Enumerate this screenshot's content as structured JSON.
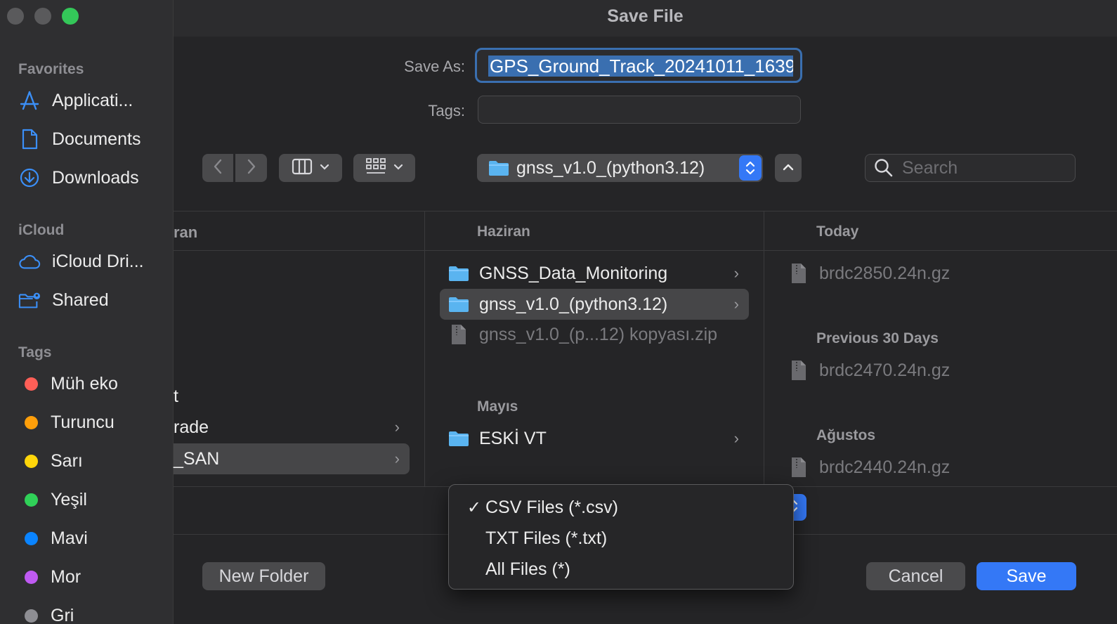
{
  "window": {
    "title": "Save File"
  },
  "save_as": {
    "label": "Save As:",
    "value": "GPS_Ground_Track_20241011_1639"
  },
  "tags_field": {
    "label": "Tags:",
    "value": ""
  },
  "toolbar": {
    "back_icon": "chevron-left-icon",
    "forward_icon": "chevron-right-icon",
    "view_icon": "columns-icon",
    "group_icon": "grid-icon",
    "location": "gnss_v1.0_(python3.12)",
    "search_placeholder": "Search"
  },
  "sidebar": {
    "favorites_header": "Favorites",
    "favorites": [
      {
        "label": "Applicati...",
        "icon": "applications-icon"
      },
      {
        "label": "Documents",
        "icon": "document-icon"
      },
      {
        "label": "Downloads",
        "icon": "download-icon"
      }
    ],
    "icloud_header": "iCloud",
    "icloud": [
      {
        "label": "iCloud Dri...",
        "icon": "cloud-icon"
      },
      {
        "label": "Shared",
        "icon": "shared-folder-icon"
      }
    ],
    "tags_header": "Tags",
    "tags": [
      {
        "label": "Müh eko",
        "color": "#ff5f57"
      },
      {
        "label": "Turuncu",
        "color": "#ff9f0a"
      },
      {
        "label": "Sarı",
        "color": "#ffd60a"
      },
      {
        "label": "Yeşil",
        "color": "#30d158"
      },
      {
        "label": "Mavi",
        "color": "#0a84ff"
      },
      {
        "label": "Mor",
        "color": "#bf5af2"
      },
      {
        "label": "Gri",
        "color": "#8e8e93"
      }
    ]
  },
  "columns": {
    "col1": {
      "header": "ran",
      "items": [
        {
          "label": "t"
        },
        {
          "label": "rade"
        },
        {
          "label": "_SAN",
          "selected": true
        }
      ]
    },
    "col2": {
      "header1": "Haziran",
      "items1": [
        {
          "label": "GNSS_Data_Monitoring",
          "kind": "folder"
        },
        {
          "label": "gnss_v1.0_(python3.12)",
          "kind": "folder",
          "selected": true
        },
        {
          "label": "gnss_v1.0_(p...12) kopyası.zip",
          "kind": "file",
          "dim": true
        }
      ],
      "header2": "Mayıs",
      "items2": [
        {
          "label": "ESKİ VT",
          "kind": "folder"
        }
      ]
    },
    "col3": {
      "header1": "Today",
      "file1": "brdc2850.24n.gz",
      "header2": "Previous 30 Days",
      "file2": "brdc2470.24n.gz",
      "header3": "Ağustos",
      "file3": "brdc2440.24n.gz"
    }
  },
  "format_menu": {
    "options": [
      {
        "label": "CSV Files (*.csv)",
        "checked": true,
        "check": "✓"
      },
      {
        "label": "TXT Files (*.txt)",
        "checked": false
      },
      {
        "label": "All Files (*)",
        "checked": false
      }
    ]
  },
  "buttons": {
    "new_folder": "New Folder",
    "cancel": "Cancel",
    "save": "Save"
  },
  "colors": {
    "accent": "#3478f6",
    "folder": "#5ab4f0"
  }
}
